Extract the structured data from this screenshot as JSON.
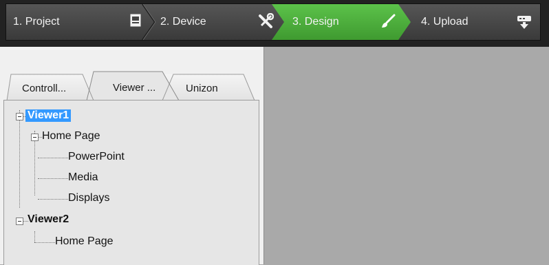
{
  "wizard": {
    "steps": [
      {
        "label": "1. Project",
        "icon": "document-icon",
        "state": "inactive"
      },
      {
        "label": "2. Device",
        "icon": "tools-icon",
        "state": "inactive"
      },
      {
        "label": "3. Design",
        "icon": "paintbrush-icon",
        "state": "active"
      },
      {
        "label": "4. Upload",
        "icon": "upload-device-icon",
        "state": "inactive"
      }
    ],
    "active_color": "#4caf3a",
    "bar_color": "#4a4a4a"
  },
  "tabs": [
    {
      "label": "Controll...",
      "selected": false
    },
    {
      "label": "Viewer ...",
      "selected": true
    },
    {
      "label": "Unizon",
      "selected": false
    }
  ],
  "tree": {
    "nodes": [
      {
        "label": "Viewer1",
        "bold": true,
        "selected": true,
        "expanded": true
      },
      {
        "label": "Home Page",
        "expanded": true
      },
      {
        "label": "PowerPoint"
      },
      {
        "label": "Media"
      },
      {
        "label": "Displays"
      },
      {
        "label": "Viewer2",
        "bold": true,
        "expanded": true
      },
      {
        "label": "Home Page"
      }
    ]
  },
  "colors": {
    "selection": "#3399ff",
    "workspace": "#a9a9a9"
  }
}
